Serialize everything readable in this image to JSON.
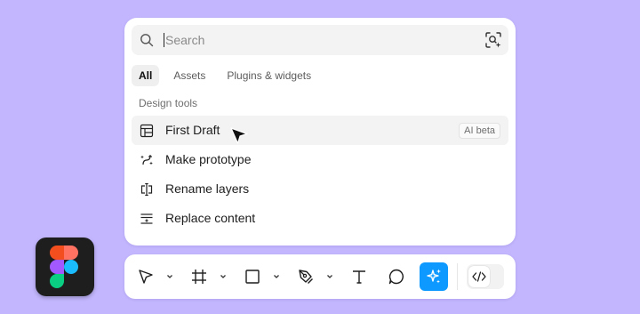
{
  "search": {
    "placeholder": "Search",
    "value": ""
  },
  "tabs": [
    {
      "label": "All",
      "active": true
    },
    {
      "label": "Assets",
      "active": false
    },
    {
      "label": "Plugins & widgets",
      "active": false
    }
  ],
  "section": {
    "title": "Design tools"
  },
  "items": [
    {
      "label": "First Draft",
      "icon": "layout-grid-icon",
      "badge": "AI beta",
      "highlighted": true
    },
    {
      "label": "Make prototype",
      "icon": "prototype-icon"
    },
    {
      "label": "Rename layers",
      "icon": "rename-layers-icon"
    },
    {
      "label": "Replace content",
      "icon": "replace-content-icon"
    }
  ],
  "toolbar": {
    "tools": [
      {
        "name": "move-tool",
        "icon": "pointer-icon",
        "has_menu": true
      },
      {
        "name": "frame-tool",
        "icon": "frame-hash-icon",
        "has_menu": true
      },
      {
        "name": "shape-tool",
        "icon": "rectangle-icon",
        "has_menu": true
      },
      {
        "name": "pen-tool",
        "icon": "pen-nib-icon",
        "has_menu": true
      },
      {
        "name": "text-tool",
        "icon": "text-t-icon",
        "has_menu": false
      },
      {
        "name": "comment-tool",
        "icon": "comment-bubble-icon",
        "has_menu": false
      },
      {
        "name": "ai-actions-tool",
        "icon": "sparkle-icon",
        "has_menu": false,
        "active": true
      }
    ],
    "dev_mode_icon": "code-brackets-icon"
  },
  "colors": {
    "background": "#c3b6fe",
    "accent": "#0d99ff",
    "logo_red": "#f24e1e",
    "logo_orange": "#ff7262",
    "logo_purple": "#a259ff",
    "logo_blue": "#1abcfe",
    "logo_green": "#0acf83"
  }
}
